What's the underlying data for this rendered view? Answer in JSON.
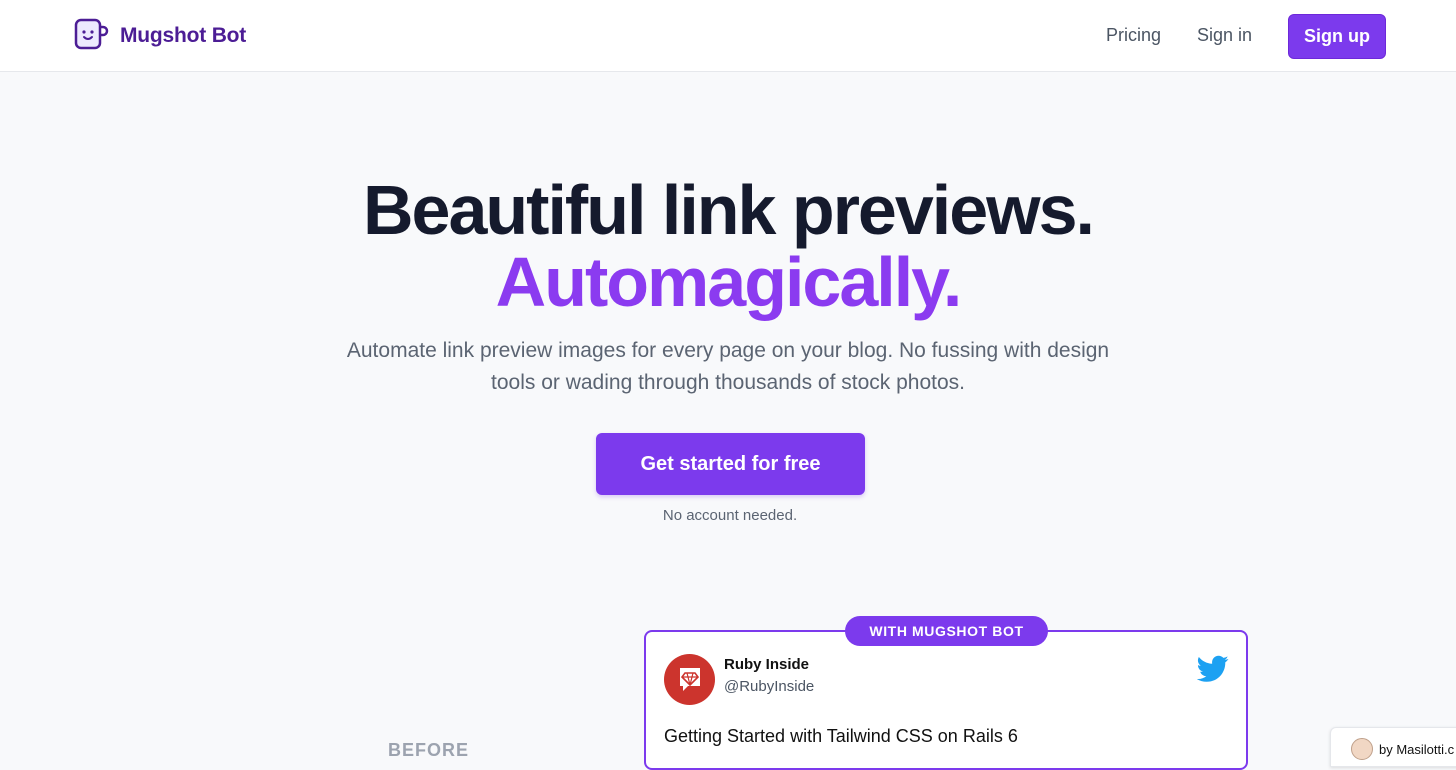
{
  "header": {
    "brand_name": "Mugshot Bot",
    "nav": {
      "pricing": "Pricing",
      "sign_in": "Sign in",
      "sign_up": "Sign up"
    }
  },
  "hero": {
    "title_line1": "Beautiful link previews.",
    "title_line2": "Automagically.",
    "subtitle": "Automate link preview images for every page on your blog. No fussing with design tools or wading through thousands of stock photos.",
    "cta_label": "Get started for free",
    "cta_note": "No account needed."
  },
  "comparison": {
    "before_label": "BEFORE",
    "after_badge": "WITH MUGSHOT BOT",
    "tweet": {
      "account_name": "Ruby Inside",
      "handle": "@RubyInside",
      "text": "Getting Started with Tailwind CSS on Rails 6"
    }
  },
  "credit": {
    "text": "by Masilotti.c"
  },
  "colors": {
    "accent": "#7c3aed",
    "brand_text": "#4c1d95",
    "title_dark": "#151a2d",
    "title_purple": "#8b3bf0",
    "ruby_red": "#cc342d",
    "twitter_blue": "#1da1f2"
  },
  "icons": {
    "brand": "mug-icon",
    "ruby": "ruby-gem-icon",
    "twitter": "twitter-bird-icon",
    "credit": "face-avatar-icon"
  }
}
